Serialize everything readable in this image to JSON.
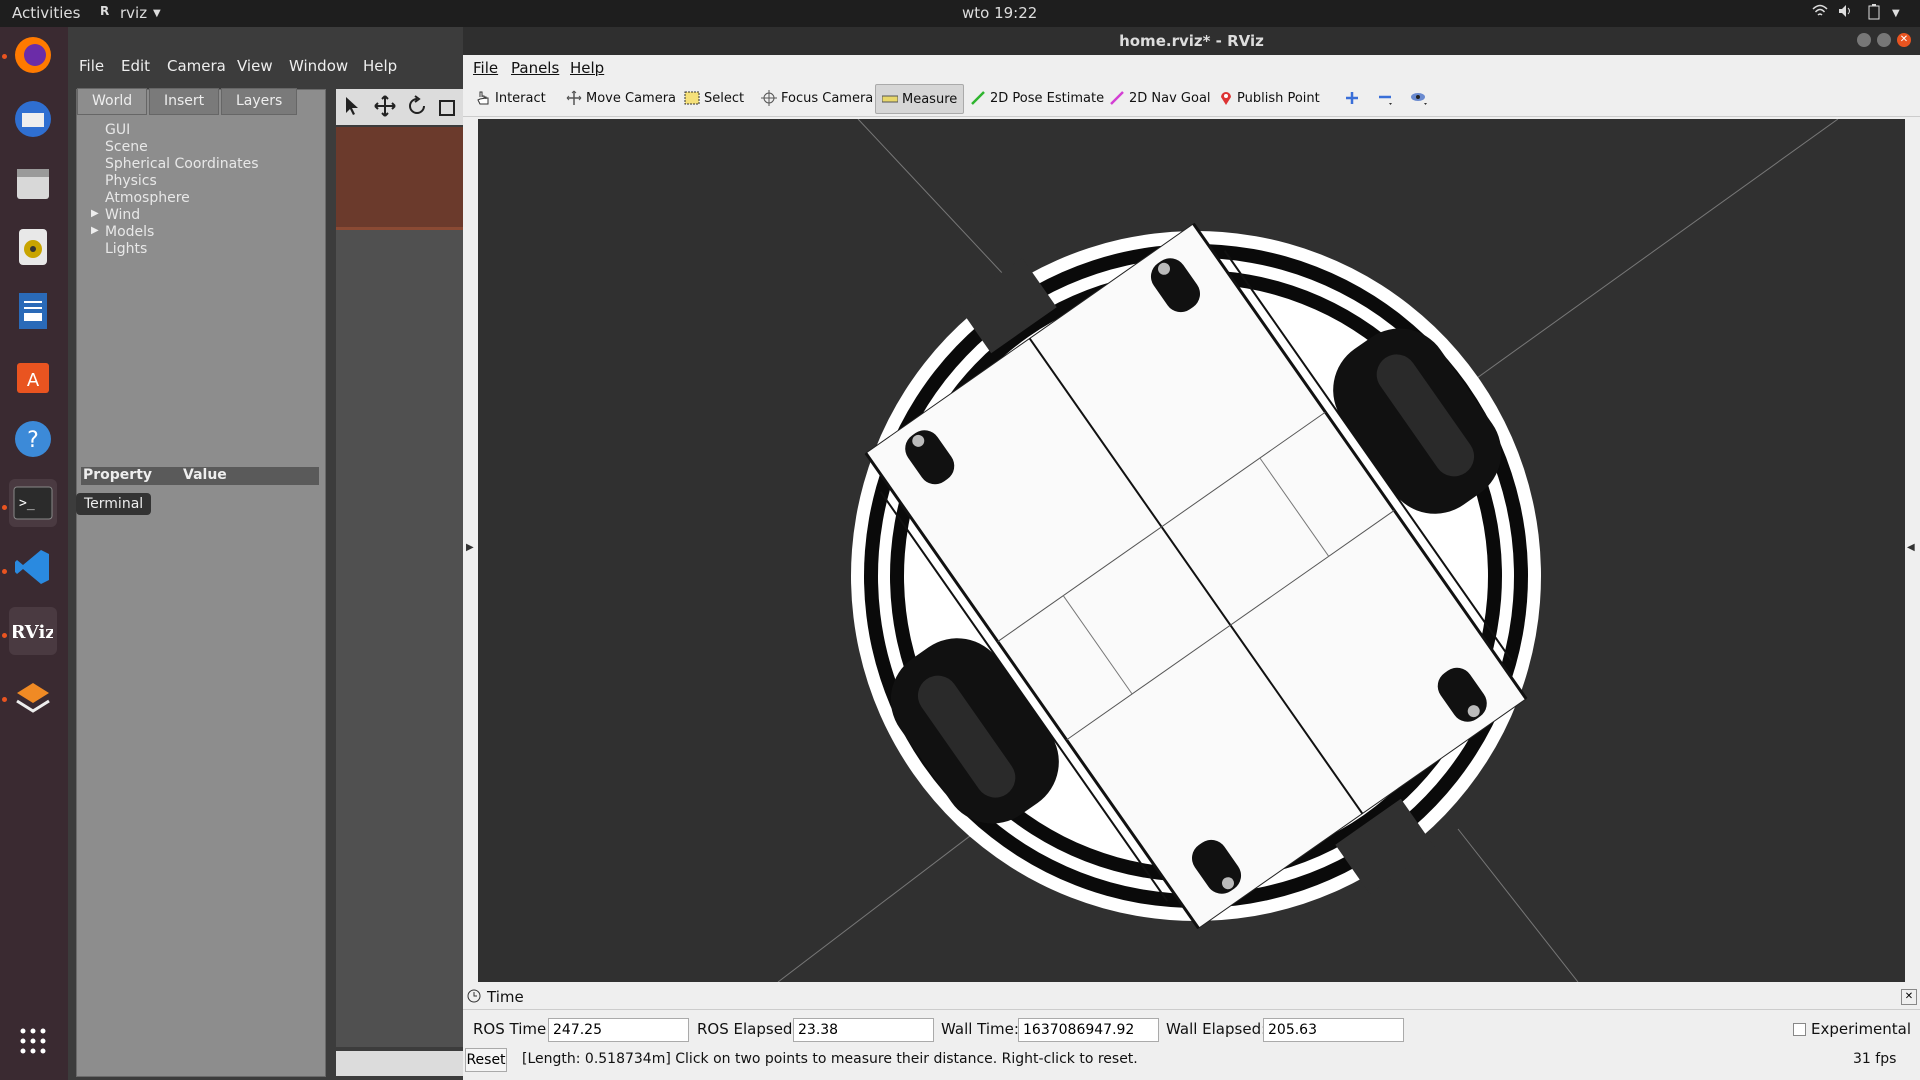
{
  "topbar": {
    "activities": "Activities",
    "app_name": "rviz",
    "clock": "wto 19:22"
  },
  "dock": {
    "tooltip": "Terminal",
    "apps": [
      "firefox-icon",
      "thunderbird-icon",
      "files-icon",
      "rhythmbox-icon",
      "writer-icon",
      "software-icon",
      "help-icon",
      "terminal-icon",
      "vscode-icon",
      "rviz-icon",
      "layers-app-icon",
      "app-grid-icon"
    ]
  },
  "gazebo": {
    "menu": [
      "File",
      "Edit",
      "Camera",
      "View",
      "Window",
      "Help"
    ],
    "tabs": [
      "World",
      "Insert",
      "Layers"
    ],
    "tree": [
      "GUI",
      "Scene",
      "Spherical Coordinates",
      "Physics",
      "Atmosphere",
      "Wind",
      "Models",
      "Lights"
    ],
    "prop_header": "Property",
    "value_header": "Value"
  },
  "rviz": {
    "title": "home.rviz* - RViz",
    "menu": [
      "File",
      "Panels",
      "Help"
    ],
    "tools": [
      "Interact",
      "Move Camera",
      "Select",
      "Focus Camera",
      "Measure",
      "2D Pose Estimate",
      "2D Nav Goal",
      "Publish Point"
    ],
    "time_panel": {
      "title": "Time",
      "ros_time_label": "ROS Time:",
      "ros_time": "247.25",
      "ros_elapsed_label": "ROS Elapsed:",
      "ros_elapsed": "23.38",
      "wall_time_label": "Wall Time:",
      "wall_time": "1637086947.92",
      "wall_elapsed_label": "Wall Elapsed:",
      "wall_elapsed": "205.63",
      "experimental": "Experimental"
    },
    "reset": "Reset",
    "status": "[Length: 0.518734m] Click on two points to measure their distance. Right-click to reset.",
    "fps": "31 fps"
  }
}
